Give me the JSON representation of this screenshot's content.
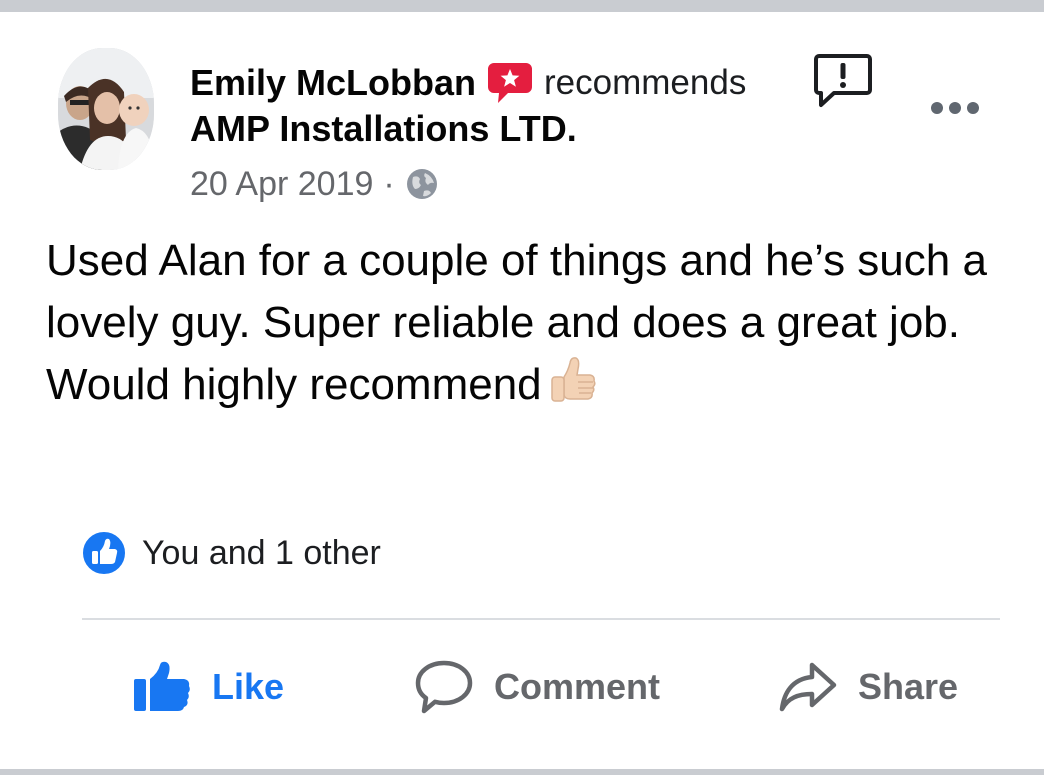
{
  "post": {
    "author": "Emily McLobban",
    "action_text": "recommends",
    "page_name": "AMP Installations LTD.",
    "date": "20 Apr 2019",
    "separator": "·",
    "privacy_icon": "globe-icon",
    "text": "Used Alan for a couple of things and he’s such a lovely guy. Super reliable and does a great job. Would highly recommend",
    "emoji": "thumbs-up-icon"
  },
  "reactions": {
    "text": "You and 1 other",
    "icon": "like-reaction-icon"
  },
  "actions": {
    "like_label": "Like",
    "comment_label": "Comment",
    "share_label": "Share"
  },
  "colors": {
    "like_blue": "#1877f2",
    "recommend_red": "#e41e3f",
    "secondary_text": "#65676b",
    "divider": "#dadde1"
  }
}
